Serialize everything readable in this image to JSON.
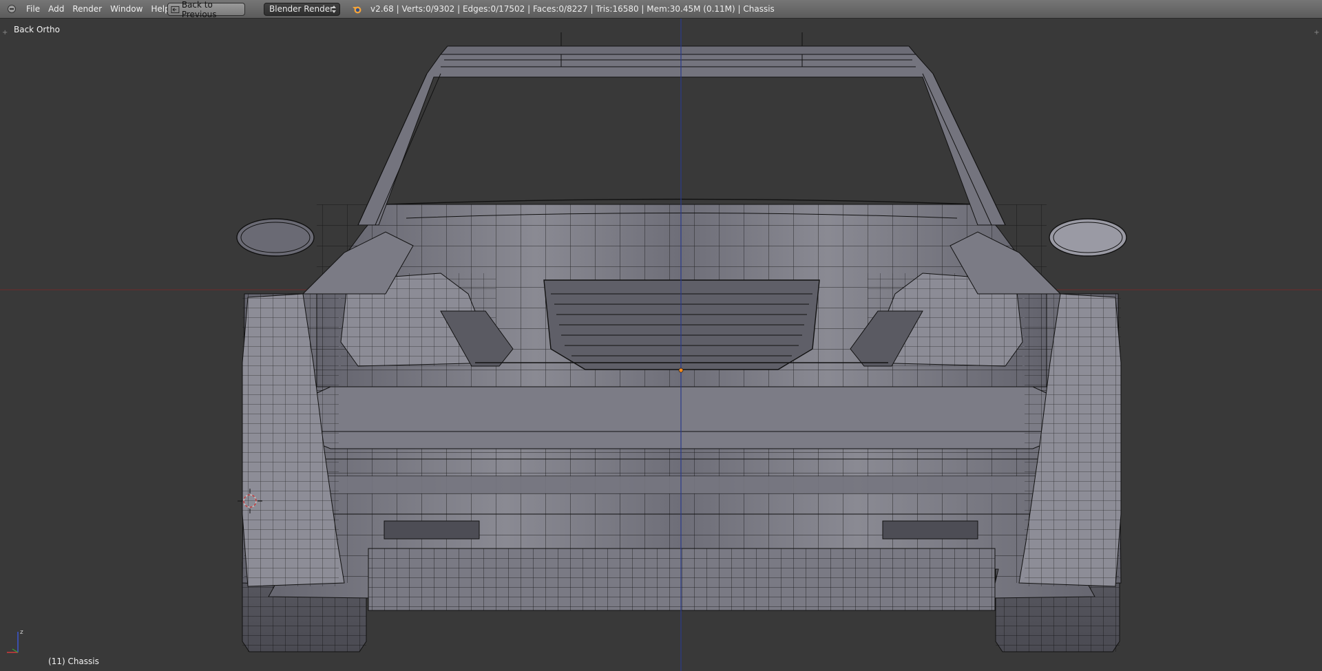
{
  "header": {
    "menus": [
      "File",
      "Add",
      "Render",
      "Window",
      "Help"
    ],
    "back_button_label": "Back to Previous",
    "render_engine": "Blender Render",
    "stats": "v2.68 | Verts:0/9302 | Edges:0/17502 | Faces:0/8227 | Tris:16580 | Mem:30.45M (0.11M) | Chassis"
  },
  "viewport": {
    "view_name": "Back Ortho",
    "active_object_label": "(11) Chassis",
    "axis_labels": {
      "z": "z"
    }
  },
  "colors": {
    "header_bg": "#6b6b6b",
    "viewport_bg": "#393939",
    "mesh_fill": "#6f6f78",
    "wire": "#111111",
    "x_axis": "#7a2a2a",
    "z_axis": "#2a3a8a",
    "origin": "#ff8c1a"
  },
  "icons": {
    "editor_type": "info-editor-icon",
    "back": "back-arrow-icon",
    "engine": "blender-logo-icon",
    "cursor": "3d-cursor-icon",
    "gizmo": "axis-gizmo-icon"
  }
}
